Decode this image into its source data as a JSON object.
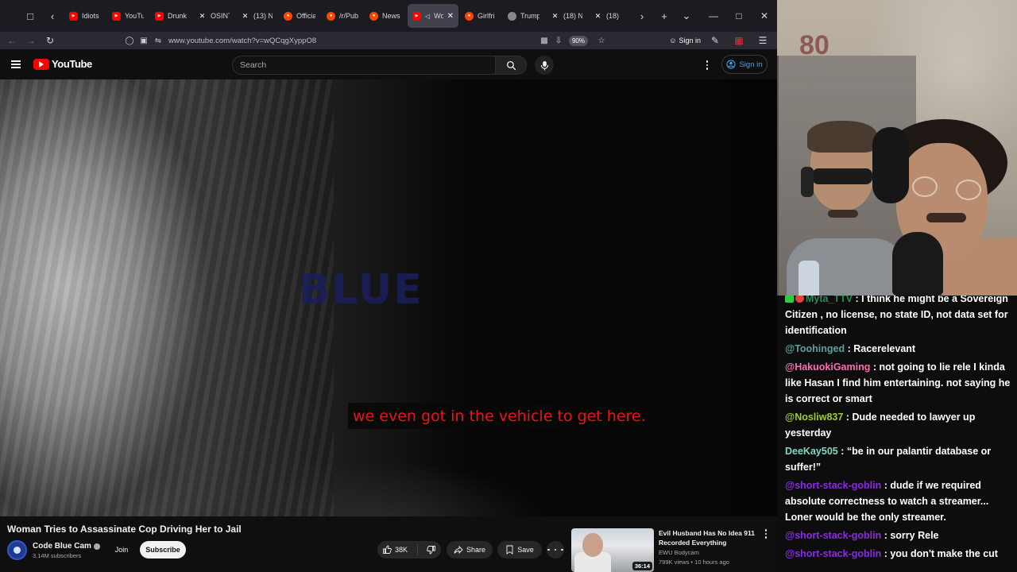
{
  "browser": {
    "tabs": [
      {
        "label": "Idiots",
        "icon": "youtube-icon",
        "color": "#ff0000"
      },
      {
        "label": "YouTu",
        "icon": "youtube-icon",
        "color": "#ff0000"
      },
      {
        "label": "Drunk",
        "icon": "youtube-icon",
        "color": "#ff0000"
      },
      {
        "label": "OSINT",
        "icon": "x-icon",
        "color": "#ffffff"
      },
      {
        "label": "(13) N",
        "icon": "x-icon",
        "color": "#ffffff"
      },
      {
        "label": "Officia",
        "icon": "reddit-icon",
        "color": "#ff4500"
      },
      {
        "label": "/r/Pub",
        "icon": "reddit-icon",
        "color": "#ff4500"
      },
      {
        "label": "News",
        "icon": "reddit-icon",
        "color": "#ff4500"
      },
      {
        "label": "Wo",
        "icon": "youtube-icon",
        "color": "#ff0000",
        "active": true
      },
      {
        "label": "Girlfri",
        "icon": "reddit-icon",
        "color": "#ff4500"
      },
      {
        "label": "Trump",
        "icon": "globe-icon",
        "color": "#888888"
      },
      {
        "label": "(18) N",
        "icon": "x-icon",
        "color": "#ffffff"
      },
      {
        "label": "(18)",
        "icon": "x-icon",
        "color": "#ffffff"
      }
    ],
    "url": "www.youtube.com/watch?v=wQCqgXyppO8",
    "zoom": "90%",
    "sign_in": "Sign in"
  },
  "youtube": {
    "logo_text": "YouTube",
    "search_placeholder": "Search",
    "sign_in": "Sign in",
    "video": {
      "overlay_text": "BLUE",
      "caption": "we even got in the vehicle to get here."
    },
    "title": "Woman Tries to Assassinate Cop Driving Her to Jail",
    "channel": {
      "name": "Code Blue Cam",
      "subscribers": "3.14M subscribers",
      "join": "Join",
      "subscribe": "Subscribe"
    },
    "actions": {
      "likes": "38K",
      "share": "Share",
      "save": "Save"
    },
    "recommended": {
      "title": "Evil Husband Has No Idea 911 Recorded Everything",
      "channel": "EWU Bodycam",
      "meta": "799K views • 10 hours ago",
      "duration": "36:14"
    }
  },
  "stream": {
    "webcam_overlay_number": "80",
    "chat": [
      {
        "user": "Myta_TTV",
        "color": "#2e8b57",
        "badges": true,
        "text": "I think he might be a Sovereign Citizen , no license, no state ID, not data set for identification"
      },
      {
        "user": "@Toohinged",
        "color": "#5f9ea0",
        "text": "Racerelevant"
      },
      {
        "user": "@HakuokiGaming",
        "color": "#ff69b4",
        "text": "not going to lie rele I kinda like Hasan I find him entertaining. not saying he is correct or smart"
      },
      {
        "user": "@Nosliw837",
        "color": "#9acd32",
        "text": "Dude needed to lawyer up yesterday"
      },
      {
        "user": "DeeKay505",
        "color": "#7fd6c2",
        "text": "“be in our palantir database or suffer!”"
      },
      {
        "user": "@short-stack-goblin",
        "color": "#8a2be2",
        "text": "dude if we required absolute correctness to watch a streamer... Loner would be the only streamer."
      },
      {
        "user": "@short-stack-goblin",
        "color": "#8a2be2",
        "text": "sorry Rele"
      },
      {
        "user": "@short-stack-goblin",
        "color": "#8a2be2",
        "text": "you don't make the cut"
      }
    ]
  }
}
